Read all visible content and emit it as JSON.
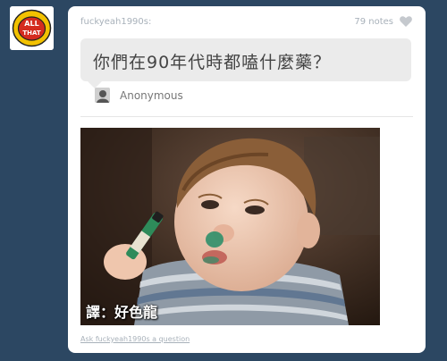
{
  "blog": {
    "avatar_icon": "all-that-logo",
    "avatar_text": "ALL THAT"
  },
  "post": {
    "username": "fuckyeah1990s:",
    "notes": "79 notes",
    "like_icon": "heart-icon",
    "question": "你們在90年代時都嗑什麼藥？",
    "asker": "Anonymous",
    "asker_icon": "anonymous-avatar-icon",
    "photo_caption": "譯：好色龍",
    "ask_link": "Ask fuckyeah1990s a question"
  },
  "colors": {
    "background": "#2c4762",
    "card": "#ffffff",
    "bubble": "#ebebeb",
    "meta_text": "#a8b1ba"
  }
}
